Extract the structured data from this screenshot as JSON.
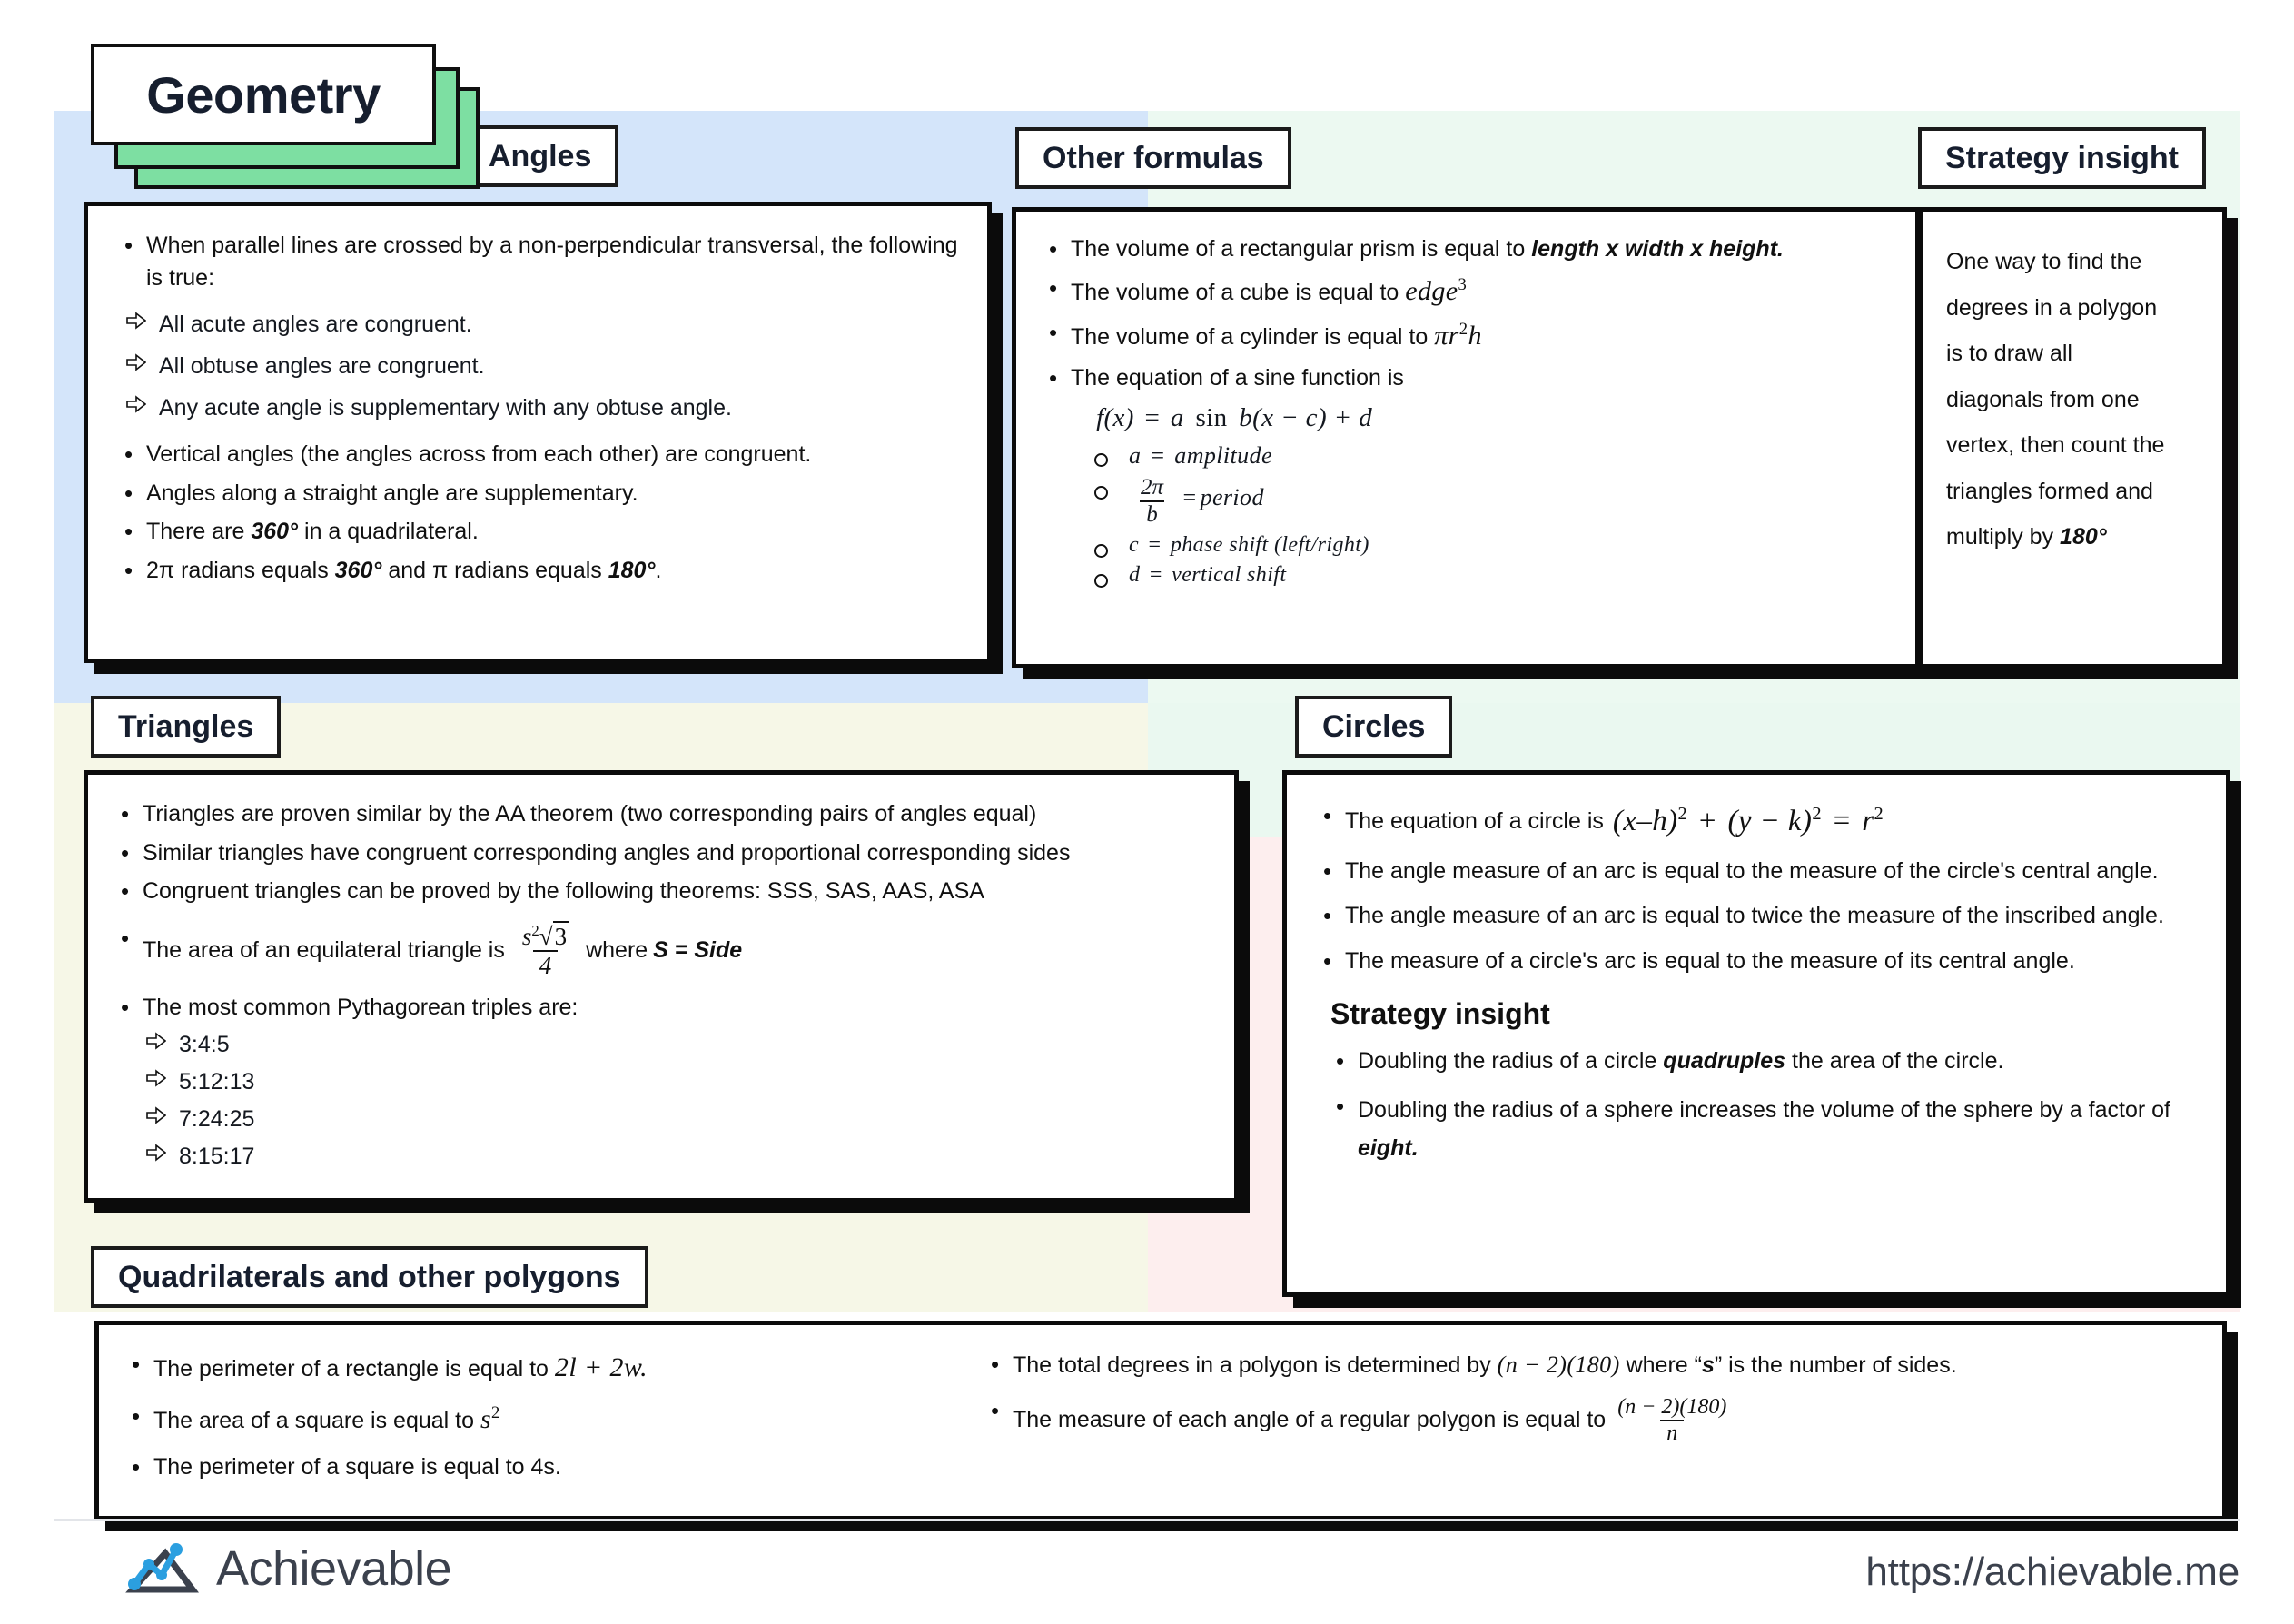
{
  "title": "Geometry",
  "sections": {
    "angles": {
      "tab": "Angles",
      "intro": "When parallel lines are crossed by a non-perpendicular transversal, the following is true:",
      "sub_items": [
        "All acute angles are congruent.",
        "All obtuse angles are congruent.",
        "Any acute angle is supplementary with any obtuse angle."
      ],
      "bullets": [
        "Vertical angles (the angles across from each other) are congruent.",
        "Angles along a straight angle are supplementary.",
        "There are 360° in a quadrilateral.",
        "2π radians equals 360° and π radians equals 180°."
      ],
      "b3_pre": "There are ",
      "b3_em": "360°",
      "b3_post": " in a quadrilateral.",
      "b4_pre": "2π radians equals ",
      "b4_em1": "360°",
      "b4_mid": " and π radians equals ",
      "b4_em2": "180°",
      "b4_post": "."
    },
    "other_formulas": {
      "tab": "Other formulas",
      "b1_pre": "The volume of a rectangular prism is equal to ",
      "b1_em": "length x width x height.",
      "b2_pre": "The volume of a cube is equal to ",
      "b2_math": "edge",
      "b2_exp": "3",
      "b3_pre": "The volume of a cylinder is equal to ",
      "b3_math": "πr",
      "b3_exp": "2",
      "b3_math2": "h",
      "b4": "The equation of a sine function is",
      "sine_eq_fx": "f(x)",
      "sine_eq_eq": "=",
      "sine_eq_body": "a",
      "sine_eq_sin": "sin",
      "sine_eq_rest": "b(x − c) + d",
      "params": [
        {
          "var": "a",
          "eq": "=",
          "desc": "amplitude"
        },
        {
          "var": "2π/b",
          "eq": "=",
          "desc": "period",
          "num": "2π",
          "den": "b"
        },
        {
          "var": "c",
          "eq": "=",
          "desc": "phase shift (left/right)"
        },
        {
          "var": "d",
          "eq": "=",
          "desc": "vertical shift"
        }
      ]
    },
    "strategy_top": {
      "tab": "Strategy insight",
      "lines": [
        "One way to find the",
        "degrees in a polygon",
        "is to draw all",
        "diagonals from one",
        "vertex, then count the",
        "triangles formed and"
      ],
      "last_pre": "multiply by ",
      "last_em": "180°"
    },
    "triangles": {
      "tab": "Triangles",
      "bullets": [
        "Triangles are proven similar by the AA theorem (two corresponding pairs of angles equal)",
        "Similar triangles have congruent corresponding angles and proportional corresponding sides",
        "Congruent triangles can be proved by the following theorems: SSS, SAS, AAS, ASA"
      ],
      "area_pre": "The area of an equilateral triangle is",
      "area_num_s": "s",
      "area_num_exp": "2",
      "area_num_rad": "3",
      "area_den": "4",
      "area_post_plain": " where ",
      "area_post_em": "S = Side",
      "triples_intro": "The most common Pythagorean triples are:",
      "triples": [
        "3:4:5",
        "5:12:13",
        "7:24:25",
        "8:15:17"
      ]
    },
    "circles": {
      "tab": "Circles",
      "eq_pre": "The equation of a circle is",
      "eq_p1": "(x–h)",
      "eq_exp1": "2",
      "eq_plus": "+",
      "eq_p2": "(y − k)",
      "eq_exp2": "2",
      "eq_eq": "=",
      "eq_r": "r",
      "eq_exp3": "2",
      "bullets": [
        "The angle measure of an arc is equal to the measure of the circle's central angle.",
        "The angle measure of an arc is equal to twice the measure of the inscribed angle.",
        "The measure of a circle's arc is equal to the measure of its central angle."
      ],
      "strategy_title": "Strategy insight",
      "s1_pre": "Doubling the radius of a circle ",
      "s1_em": "quadruples",
      "s1_post": " the area of the circle.",
      "s2_pre": "Doubling the radius of a sphere increases the volume of the sphere by a factor of ",
      "s2_em": "eight."
    },
    "quadrilaterals": {
      "tab": "Quadrilaterals and other polygons",
      "left": {
        "b1_pre": "The perimeter of a rectangle is equal to ",
        "b1_math": "2l + 2w.",
        "b2_pre": "The area of a square is equal to ",
        "b2_math": "s",
        "b2_exp": "2",
        "b3": "The perimeter of a square is equal to 4s."
      },
      "right": {
        "b1_pre": "The total degrees in a polygon is determined by ",
        "b1_math": "(n − 2)(180)",
        "b1_mid": " where “",
        "b1_em": "s",
        "b1_post": "” is the number of sides.",
        "b2_pre": "The measure of each angle of a regular polygon is equal to ",
        "b2_num": "(n − 2)(180)",
        "b2_den": "n"
      }
    }
  },
  "footer": {
    "brand": "Achievable",
    "url": "https://achievable.me"
  },
  "colors": {
    "tint_blue": "#d4e5fa",
    "tint_mint": "#ecf9f1",
    "tint_yellow": "#f6f7e7",
    "tint_pink": "#fdeeee",
    "title_green": "#7ddfa2",
    "ink": "#101010",
    "brand_blue": "#2b9fe0",
    "brand_dark": "#3b414d"
  }
}
